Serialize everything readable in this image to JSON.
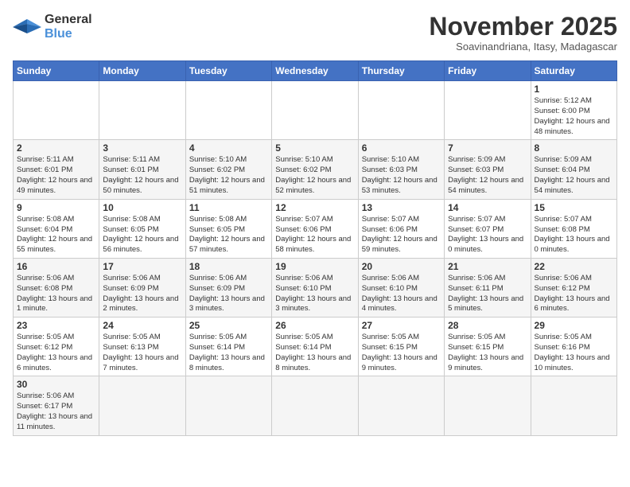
{
  "logo": {
    "line1": "General",
    "line2": "Blue"
  },
  "title": "November 2025",
  "subtitle": "Soavinandriana, Itasy, Madagascar",
  "days_of_week": [
    "Sunday",
    "Monday",
    "Tuesday",
    "Wednesday",
    "Thursday",
    "Friday",
    "Saturday"
  ],
  "weeks": [
    [
      {
        "day": "",
        "info": ""
      },
      {
        "day": "",
        "info": ""
      },
      {
        "day": "",
        "info": ""
      },
      {
        "day": "",
        "info": ""
      },
      {
        "day": "",
        "info": ""
      },
      {
        "day": "",
        "info": ""
      },
      {
        "day": "1",
        "info": "Sunrise: 5:12 AM\nSunset: 6:00 PM\nDaylight: 12 hours\nand 48 minutes."
      }
    ],
    [
      {
        "day": "2",
        "info": "Sunrise: 5:11 AM\nSunset: 6:01 PM\nDaylight: 12 hours\nand 49 minutes."
      },
      {
        "day": "3",
        "info": "Sunrise: 5:11 AM\nSunset: 6:01 PM\nDaylight: 12 hours\nand 50 minutes."
      },
      {
        "day": "4",
        "info": "Sunrise: 5:10 AM\nSunset: 6:02 PM\nDaylight: 12 hours\nand 51 minutes."
      },
      {
        "day": "5",
        "info": "Sunrise: 5:10 AM\nSunset: 6:02 PM\nDaylight: 12 hours\nand 52 minutes."
      },
      {
        "day": "6",
        "info": "Sunrise: 5:10 AM\nSunset: 6:03 PM\nDaylight: 12 hours\nand 53 minutes."
      },
      {
        "day": "7",
        "info": "Sunrise: 5:09 AM\nSunset: 6:03 PM\nDaylight: 12 hours\nand 54 minutes."
      },
      {
        "day": "8",
        "info": "Sunrise: 5:09 AM\nSunset: 6:04 PM\nDaylight: 12 hours\nand 54 minutes."
      }
    ],
    [
      {
        "day": "9",
        "info": "Sunrise: 5:08 AM\nSunset: 6:04 PM\nDaylight: 12 hours\nand 55 minutes."
      },
      {
        "day": "10",
        "info": "Sunrise: 5:08 AM\nSunset: 6:05 PM\nDaylight: 12 hours\nand 56 minutes."
      },
      {
        "day": "11",
        "info": "Sunrise: 5:08 AM\nSunset: 6:05 PM\nDaylight: 12 hours\nand 57 minutes."
      },
      {
        "day": "12",
        "info": "Sunrise: 5:07 AM\nSunset: 6:06 PM\nDaylight: 12 hours\nand 58 minutes."
      },
      {
        "day": "13",
        "info": "Sunrise: 5:07 AM\nSunset: 6:06 PM\nDaylight: 12 hours\nand 59 minutes."
      },
      {
        "day": "14",
        "info": "Sunrise: 5:07 AM\nSunset: 6:07 PM\nDaylight: 13 hours\nand 0 minutes."
      },
      {
        "day": "15",
        "info": "Sunrise: 5:07 AM\nSunset: 6:08 PM\nDaylight: 13 hours\nand 0 minutes."
      }
    ],
    [
      {
        "day": "16",
        "info": "Sunrise: 5:06 AM\nSunset: 6:08 PM\nDaylight: 13 hours\nand 1 minute."
      },
      {
        "day": "17",
        "info": "Sunrise: 5:06 AM\nSunset: 6:09 PM\nDaylight: 13 hours\nand 2 minutes."
      },
      {
        "day": "18",
        "info": "Sunrise: 5:06 AM\nSunset: 6:09 PM\nDaylight: 13 hours\nand 3 minutes."
      },
      {
        "day": "19",
        "info": "Sunrise: 5:06 AM\nSunset: 6:10 PM\nDaylight: 13 hours\nand 3 minutes."
      },
      {
        "day": "20",
        "info": "Sunrise: 5:06 AM\nSunset: 6:10 PM\nDaylight: 13 hours\nand 4 minutes."
      },
      {
        "day": "21",
        "info": "Sunrise: 5:06 AM\nSunset: 6:11 PM\nDaylight: 13 hours\nand 5 minutes."
      },
      {
        "day": "22",
        "info": "Sunrise: 5:06 AM\nSunset: 6:12 PM\nDaylight: 13 hours\nand 6 minutes."
      }
    ],
    [
      {
        "day": "23",
        "info": "Sunrise: 5:05 AM\nSunset: 6:12 PM\nDaylight: 13 hours\nand 6 minutes."
      },
      {
        "day": "24",
        "info": "Sunrise: 5:05 AM\nSunset: 6:13 PM\nDaylight: 13 hours\nand 7 minutes."
      },
      {
        "day": "25",
        "info": "Sunrise: 5:05 AM\nSunset: 6:14 PM\nDaylight: 13 hours\nand 8 minutes."
      },
      {
        "day": "26",
        "info": "Sunrise: 5:05 AM\nSunset: 6:14 PM\nDaylight: 13 hours\nand 8 minutes."
      },
      {
        "day": "27",
        "info": "Sunrise: 5:05 AM\nSunset: 6:15 PM\nDaylight: 13 hours\nand 9 minutes."
      },
      {
        "day": "28",
        "info": "Sunrise: 5:05 AM\nSunset: 6:15 PM\nDaylight: 13 hours\nand 9 minutes."
      },
      {
        "day": "29",
        "info": "Sunrise: 5:05 AM\nSunset: 6:16 PM\nDaylight: 13 hours\nand 10 minutes."
      }
    ],
    [
      {
        "day": "30",
        "info": "Sunrise: 5:06 AM\nSunset: 6:17 PM\nDaylight: 13 hours\nand 11 minutes."
      },
      {
        "day": "",
        "info": ""
      },
      {
        "day": "",
        "info": ""
      },
      {
        "day": "",
        "info": ""
      },
      {
        "day": "",
        "info": ""
      },
      {
        "day": "",
        "info": ""
      },
      {
        "day": "",
        "info": ""
      }
    ]
  ]
}
